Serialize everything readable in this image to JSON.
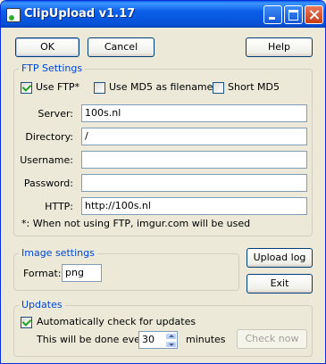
{
  "window": {
    "title": "ClipUpload v1.17",
    "app_icon": "clipboard-upload-icon"
  },
  "toolbar": {
    "ok_label": "OK",
    "cancel_label": "Cancel",
    "help_label": "Help"
  },
  "ftp": {
    "legend": "FTP Settings",
    "use_ftp": {
      "label": "Use FTP*",
      "checked": true
    },
    "use_md5": {
      "label": "Use MD5 as filename",
      "checked": false
    },
    "short_md5": {
      "label": "Short MD5",
      "checked": false
    },
    "fields": [
      {
        "label": "Server:",
        "value": "100s.nl"
      },
      {
        "label": "Directory:",
        "value": "/"
      },
      {
        "label": "Username:",
        "value": ""
      },
      {
        "label": "Password:",
        "value": ""
      },
      {
        "label": "HTTP:",
        "value": "http://100s.nl"
      }
    ],
    "note": "*: When not using FTP, imgur.com will be used"
  },
  "image": {
    "legend": "Image settings",
    "format_label": "Format:",
    "format_value": "png"
  },
  "side_buttons": {
    "upload_log_label": "Upload log",
    "exit_label": "Exit"
  },
  "updates": {
    "legend": "Updates",
    "auto_check": {
      "label": "Automatically check for updates",
      "checked": true
    },
    "interval_prefix": "This will be done every",
    "interval_value": "30",
    "interval_suffix": "minutes",
    "check_now_label": "Check now"
  },
  "colors": {
    "titlebar": "#0a5ee8",
    "group_legend": "#0046d5",
    "dialog_bg": "#ece9d8"
  }
}
